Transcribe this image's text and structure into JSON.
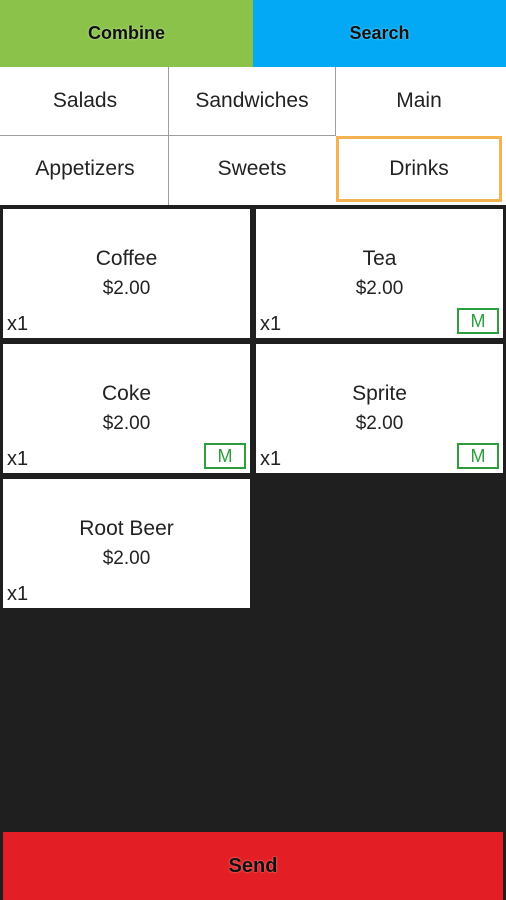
{
  "topbar": {
    "combine_label": "Combine",
    "search_label": "Search",
    "combine_color": "#8bc34a",
    "search_color": "#03a9f4"
  },
  "categories": [
    {
      "label": "Salads",
      "selected": false
    },
    {
      "label": "Sandwiches",
      "selected": false
    },
    {
      "label": "Main",
      "selected": false
    },
    {
      "label": "Appetizers",
      "selected": false
    },
    {
      "label": "Sweets",
      "selected": false
    },
    {
      "label": "Drinks",
      "selected": true
    }
  ],
  "items": [
    {
      "name": "Coffee",
      "price": "$2.00",
      "qty": "x1",
      "modifier": ""
    },
    {
      "name": "Tea",
      "price": "$2.00",
      "qty": "x1",
      "modifier": "M"
    },
    {
      "name": "Coke",
      "price": "$2.00",
      "qty": "x1",
      "modifier": "M"
    },
    {
      "name": "Sprite",
      "price": "$2.00",
      "qty": "x1",
      "modifier": "M"
    },
    {
      "name": "Root Beer",
      "price": "$2.00",
      "qty": "x1",
      "modifier": ""
    }
  ],
  "send": {
    "label": "Send",
    "color": "#e31e24"
  },
  "colors": {
    "selected_category_border": "#f4b350",
    "modifier_badge": "#2e9d3e",
    "background": "#1f1f1f"
  }
}
